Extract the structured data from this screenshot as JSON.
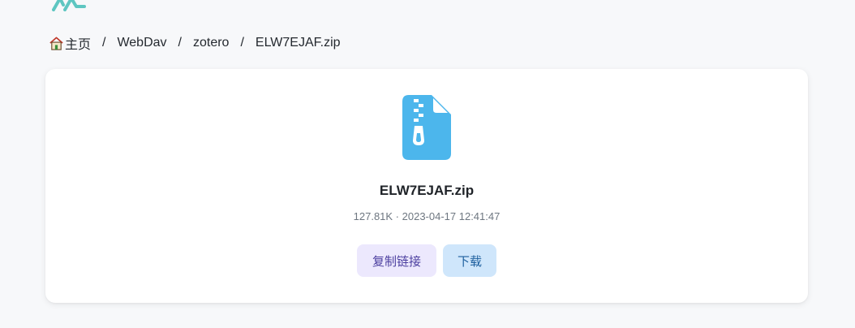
{
  "breadcrumb": {
    "items": [
      {
        "label": "主页",
        "icon": "home-icon"
      },
      {
        "label": "WebDav"
      },
      {
        "label": "zotero"
      },
      {
        "label": "ELW7EJAF.zip"
      }
    ],
    "separator": "/"
  },
  "file": {
    "icon": "zip-file-icon",
    "name": "ELW7EJAF.zip",
    "meta": "127.81K · 2023-04-17 12:41:47"
  },
  "actions": {
    "copy_link_label": "复制链接",
    "download_label": "下载"
  },
  "colors": {
    "page_background": "#f7f8fa",
    "file_icon": "#4cb6ec",
    "copy_button_bg": "#ece8fd",
    "download_button_bg": "#cfe6fb",
    "logo": "#5ec6c1"
  }
}
